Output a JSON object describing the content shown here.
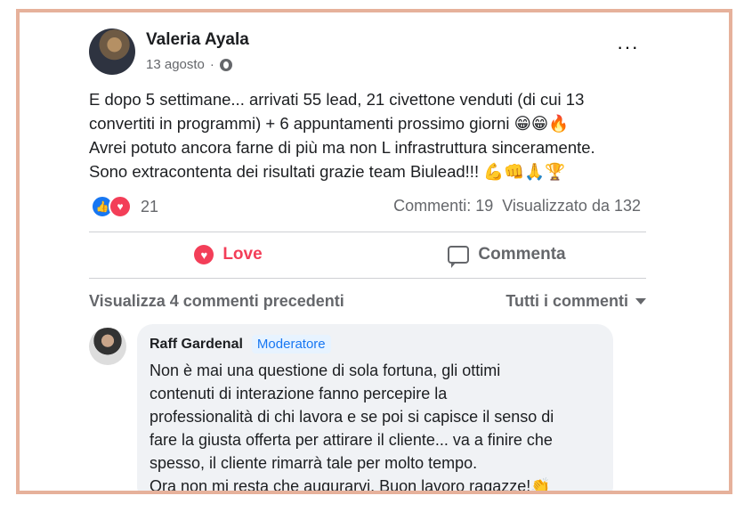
{
  "post": {
    "author": "Valeria Ayala",
    "date": "13 agosto",
    "more_label": "···",
    "body_lines": [
      "E dopo 5 settimane... arrivati 55 lead, 21 civettone venduti (di cui 13",
      "convertiti in programmi) + 6 appuntamenti prossimo giorni 😁😁🔥",
      "Avrei potuto ancora farne di più ma non L infrastruttura sinceramente.",
      "Sono extracontenta dei risultati grazie team Biulead!!! 💪👊🙏🏆"
    ],
    "reaction_count": "21",
    "comments_count": "Commenti: 19",
    "views": "Visualizzato da 132"
  },
  "actions": {
    "love_label": "Love",
    "comment_label": "Commenta"
  },
  "comments": {
    "view_previous": "Visualizza 4 commenti precedenti",
    "sort_label": "Tutti i commenti",
    "items": [
      {
        "author": "Raff Gardenal",
        "badge": "Moderatore",
        "lines": [
          "Non è mai una questione di sola fortuna, gli ottimi",
          "contenuti di interazione fanno percepire la",
          "professionalità di chi lavora e se poi si capisce il senso di",
          "fare la giusta offerta per attirare il cliente... va a finire che",
          "spesso, il cliente rimarrà tale per molto tempo.",
          "Ora non mi resta che augurarvi. Buon lavoro ragazze!👏"
        ]
      }
    ]
  },
  "colors": {
    "frame": "#e6b19b",
    "love": "#f33e58",
    "like": "#1877f2"
  },
  "icons": [
    "globe-icon",
    "more-icon",
    "like-icon",
    "love-icon",
    "comment-icon",
    "caret-down-icon"
  ]
}
